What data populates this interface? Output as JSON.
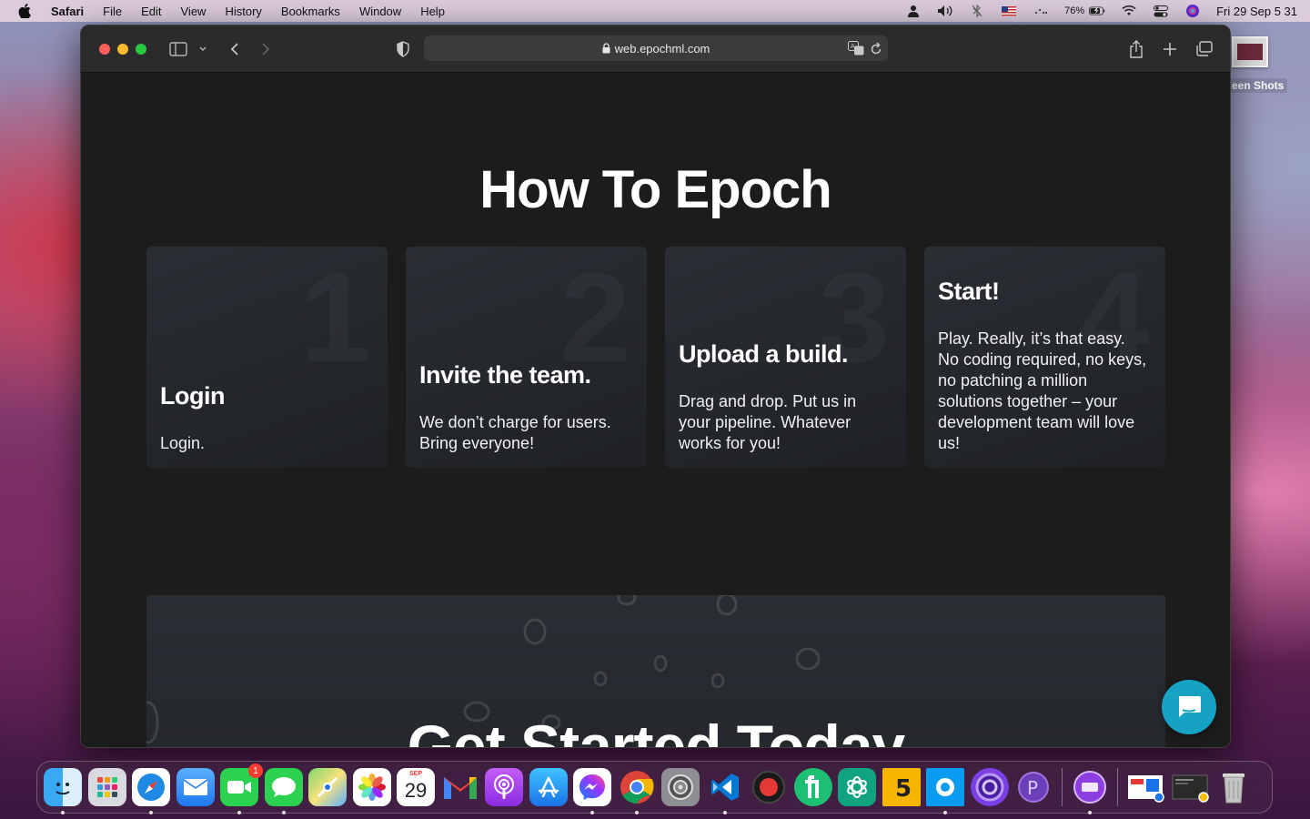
{
  "menubar": {
    "app_name": "Safari",
    "items": [
      "File",
      "Edit",
      "View",
      "History",
      "Bookmarks",
      "Window",
      "Help"
    ],
    "battery": "76%",
    "clock": "Fri 29 Sep  5 31"
  },
  "desktop": {
    "folder_label": "een Shots"
  },
  "browser": {
    "url": "web.epochml.com"
  },
  "page": {
    "title": "How To Epoch",
    "cards": [
      {
        "number": "1",
        "heading": "Login",
        "description": "Login."
      },
      {
        "number": "2",
        "heading": "Invite the team.",
        "description": "We don’t charge for users. Bring everyone!"
      },
      {
        "number": "3",
        "heading": "Upload a build.",
        "description": "Drag and drop. Put us in your pipeline. Whatever works for you!"
      },
      {
        "number": "4",
        "heading": "Start!",
        "description": "Play. Really, it’s that easy. No coding required, no keys, no patching a million solutions together – your development team will love us!"
      }
    ],
    "get_started": "Get Started Today"
  },
  "dock": {
    "calendar_month": "SEP",
    "calendar_day": "29",
    "facetime_badge": "1",
    "apps": [
      "finder-icon",
      "launchpad-icon",
      "safari-icon",
      "mail-icon",
      "facetime-icon",
      "messages-icon",
      "maps-icon",
      "photos-icon",
      "calendar-icon",
      "gmail-icon",
      "podcasts-icon",
      "app-store-icon",
      "messenger-icon",
      "chrome-icon",
      "system-preferences-icon",
      "vscode-icon",
      "record-icon",
      "fiverr-icon",
      "chatgpt-icon",
      "html5-icon",
      "circle-app-icon",
      "podcast-app-icon",
      "p-app-icon",
      "storage-app-icon",
      "screenshot-stack-icon",
      "window-stack-icon",
      "trash-icon"
    ]
  },
  "colors": {
    "accent_chat": "#16a2c2",
    "page_bg": "#1c1c1c",
    "card_bg": "#2a2d33"
  }
}
